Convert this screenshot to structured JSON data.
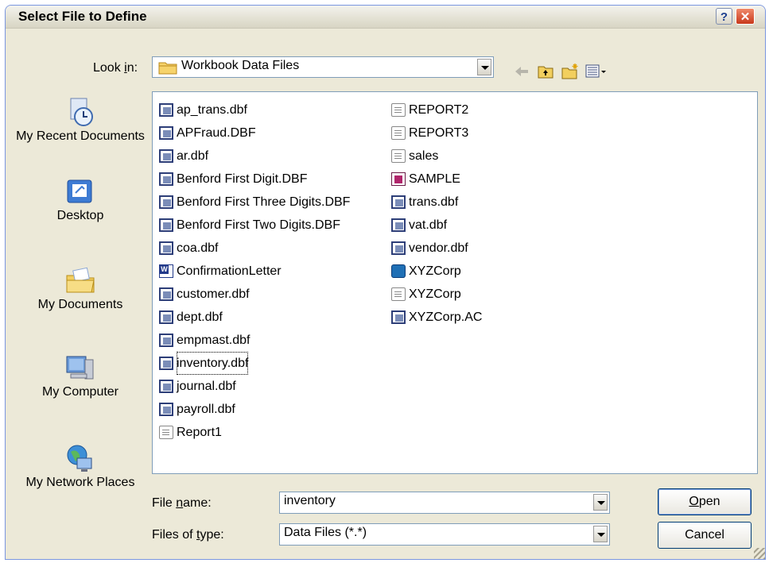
{
  "window": {
    "title": "Select File to Define",
    "help_label": "?",
    "close_label": "✕"
  },
  "look_in": {
    "label_prefix": "Look ",
    "label_mnemonic": "i",
    "label_suffix": "n:",
    "value": "Workbook Data Files"
  },
  "toolbar": {
    "back_icon": "back-arrow-icon",
    "up_icon": "up-folder-icon",
    "new_folder_icon": "new-folder-icon",
    "views_icon": "views-menu-icon"
  },
  "places": [
    {
      "label": "My Recent Documents",
      "icon": "recent-documents-icon"
    },
    {
      "label": "Desktop",
      "icon": "desktop-icon"
    },
    {
      "label": "My Documents",
      "icon": "my-documents-icon"
    },
    {
      "label": "My Computer",
      "icon": "my-computer-icon"
    },
    {
      "label": "My Network Places",
      "icon": "network-places-icon"
    }
  ],
  "files": {
    "column1": [
      {
        "name": "ap_trans.dbf",
        "type": "dbf"
      },
      {
        "name": "APFraud.DBF",
        "type": "dbf"
      },
      {
        "name": "ar.dbf",
        "type": "dbf"
      },
      {
        "name": "Benford First Digit.DBF",
        "type": "dbf"
      },
      {
        "name": "Benford First Three Digits.DBF",
        "type": "dbf"
      },
      {
        "name": "Benford First Two Digits.DBF",
        "type": "dbf"
      },
      {
        "name": "coa.dbf",
        "type": "dbf"
      },
      {
        "name": "ConfirmationLetter",
        "type": "doc"
      },
      {
        "name": "customer.dbf",
        "type": "dbf"
      },
      {
        "name": "dept.dbf",
        "type": "dbf"
      },
      {
        "name": "empmast.dbf",
        "type": "dbf"
      },
      {
        "name": "inventory.dbf",
        "type": "dbf"
      },
      {
        "name": "journal.dbf",
        "type": "dbf"
      },
      {
        "name": "payroll.dbf",
        "type": "dbf"
      },
      {
        "name": "Report1",
        "type": "txt"
      }
    ],
    "column2": [
      {
        "name": "REPORT2",
        "type": "txt"
      },
      {
        "name": "REPORT3",
        "type": "txt"
      },
      {
        "name": "sales",
        "type": "txt"
      },
      {
        "name": "SAMPLE",
        "type": "pdf"
      },
      {
        "name": "trans.dbf",
        "type": "dbf"
      },
      {
        "name": "vat.dbf",
        "type": "dbf"
      },
      {
        "name": "vendor.dbf",
        "type": "dbf"
      },
      {
        "name": "XYZCorp",
        "type": "app"
      },
      {
        "name": "XYZCorp",
        "type": "txt"
      },
      {
        "name": "XYZCorp.AC",
        "type": "dbf"
      }
    ]
  },
  "file_name": {
    "label_prefix": "File ",
    "label_mnemonic": "n",
    "label_suffix": "ame:",
    "value": "inventory"
  },
  "file_type": {
    "label_prefix": "Files of ",
    "label_mnemonic": "t",
    "label_suffix": "ype:",
    "value": "Data Files (*.*)"
  },
  "buttons": {
    "open_mnemonic": "O",
    "open_rest": "pen",
    "cancel": "Cancel"
  },
  "colors": {
    "dialog_bg": "#ece9d8",
    "field_border": "#7f9db9",
    "close_red": "#c8391b"
  }
}
